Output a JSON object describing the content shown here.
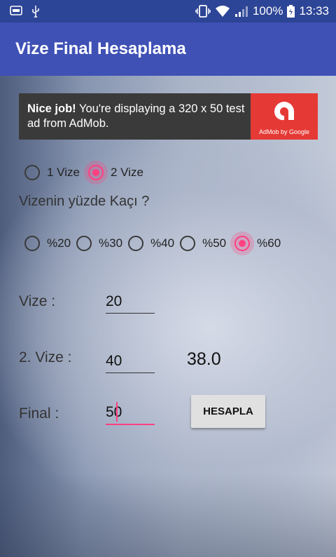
{
  "status_bar": {
    "left_icons": [
      "notification-count-icon",
      "usb-icon"
    ],
    "battery_percent": "100%",
    "time": "13:33",
    "right_icons": [
      "vibrate-icon",
      "wifi-icon",
      "signal-icon",
      "battery-icon"
    ]
  },
  "app_bar": {
    "title": "Vize Final Hesaplama"
  },
  "ad": {
    "strong": "Nice job!",
    "text": " You're displaying a 320 x 50 test ad from AdMob.",
    "brand": "AdMob by Google"
  },
  "vize_count": {
    "options": [
      {
        "label": "1 Vize",
        "selected": false
      },
      {
        "label": "2 Vize",
        "selected": true
      }
    ]
  },
  "question": "Vizenin yüzde Kaçı ?",
  "percent": {
    "options": [
      {
        "label": "%20",
        "selected": false
      },
      {
        "label": "%30",
        "selected": false
      },
      {
        "label": "%40",
        "selected": false
      },
      {
        "label": "%50",
        "selected": false
      },
      {
        "label": "%60",
        "selected": true
      }
    ]
  },
  "fields": {
    "vize1": {
      "label": "Vize :",
      "value": "20"
    },
    "vize2": {
      "label": "2. Vize :",
      "value": "40"
    },
    "final": {
      "label": "Final :",
      "value": "50"
    }
  },
  "result": "38.0",
  "button": {
    "label": "HESAPLA"
  },
  "colors": {
    "app_bar": "#3f51b5",
    "status_bar": "#2d4596",
    "accent": "#ff4081",
    "ad_logo": "#e53935"
  }
}
